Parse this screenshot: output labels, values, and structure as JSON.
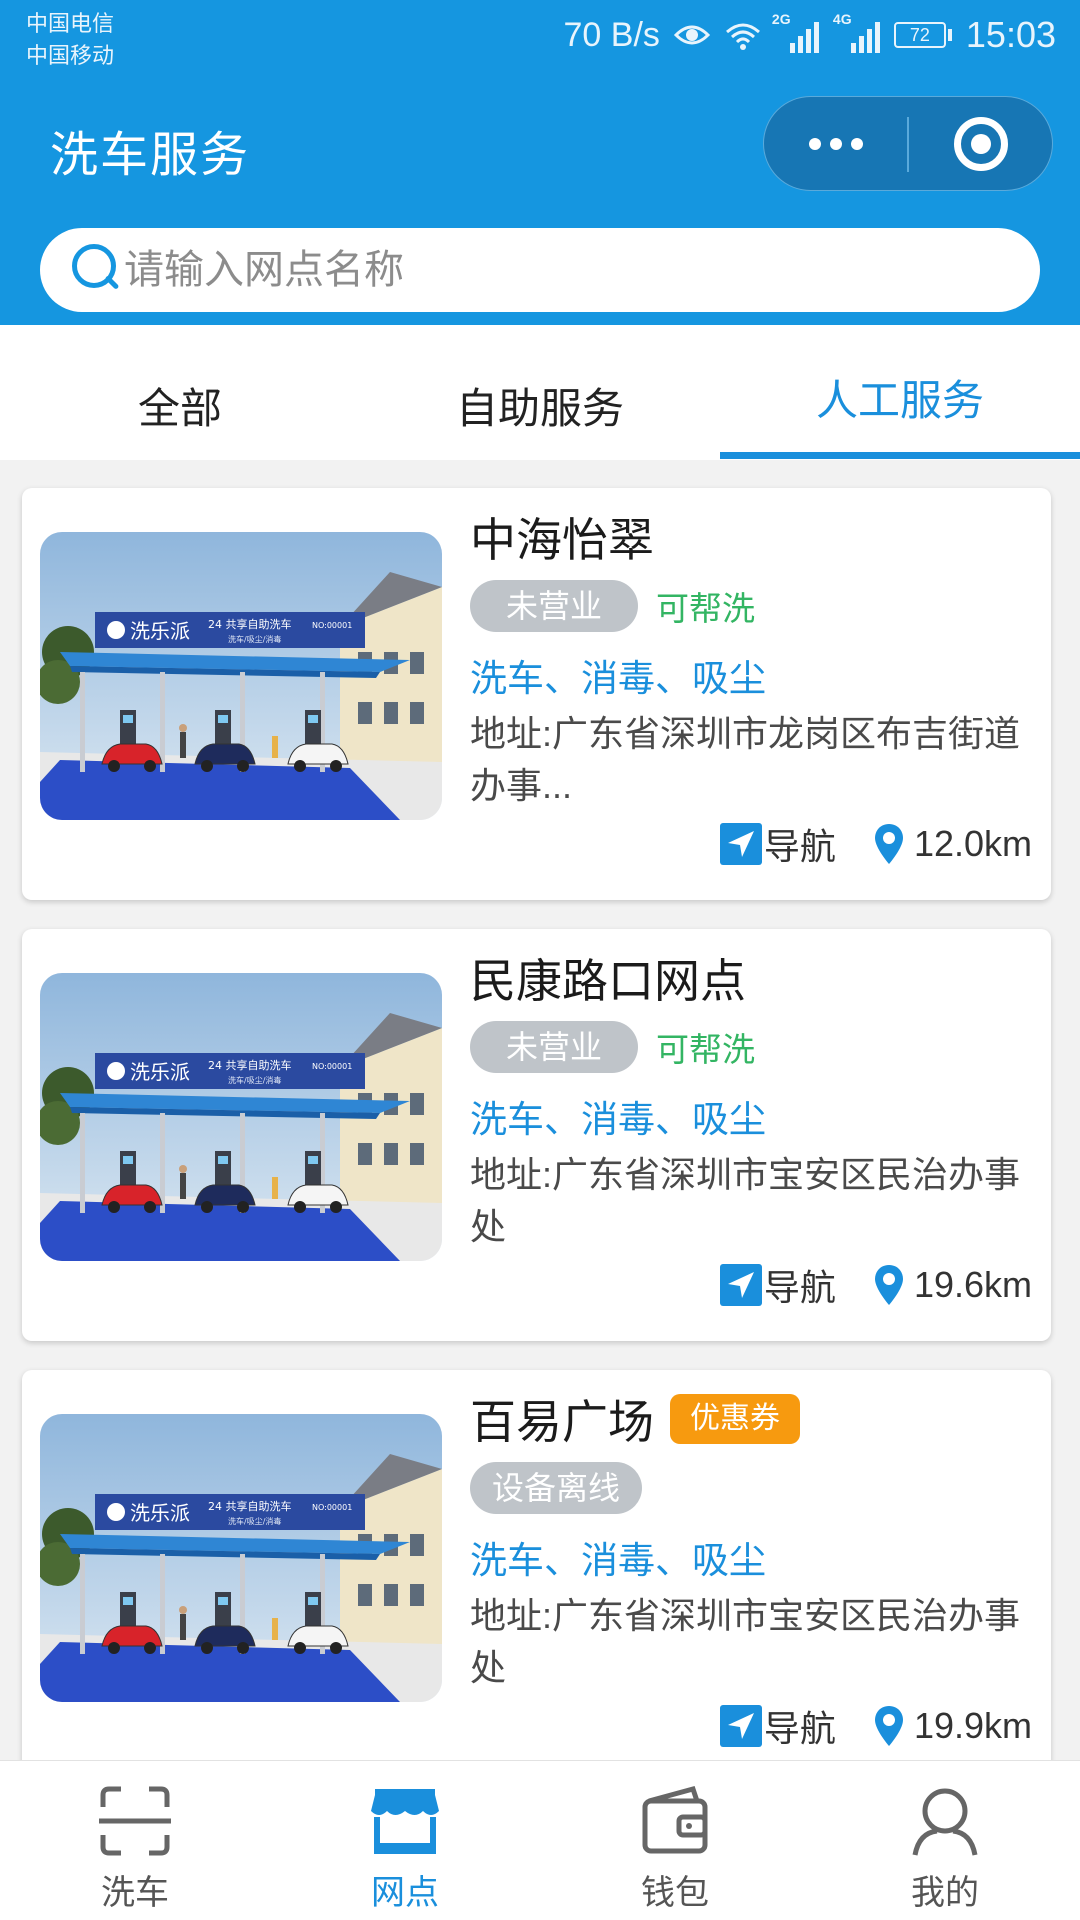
{
  "status_bar": {
    "carrier_1": "中国电信",
    "carrier_2": "中国移动",
    "net_speed": "70 B/s",
    "sig1_label": "2G",
    "sig2_label": "4G",
    "battery": "72",
    "time": "15:03",
    "icons": [
      "eye-icon",
      "wifi-icon",
      "signal-icon",
      "battery-icon"
    ]
  },
  "header": {
    "title": "洗车服务",
    "more_icon": "more-dots-icon",
    "close_icon": "target-circle-icon"
  },
  "search": {
    "placeholder": "请输入网点名称",
    "value": "",
    "icon": "search-icon"
  },
  "tabs": [
    {
      "label": "全部",
      "active": false
    },
    {
      "label": "自助服务",
      "active": false
    },
    {
      "label": "人工服务",
      "active": true
    }
  ],
  "stations": [
    {
      "name": "中海怡翠",
      "coupon": "",
      "status": "未营业",
      "help_wash": "可帮洗",
      "services": "洗车、消毒、吸尘",
      "address": "地址:广东省深圳市龙岗区布吉街道办事...",
      "nav_label": "导航",
      "distance": "12.0km"
    },
    {
      "name": "民康路口网点",
      "coupon": "",
      "status": "未营业",
      "help_wash": "可帮洗",
      "services": "洗车、消毒、吸尘",
      "address": "地址:广东省深圳市宝安区民治办事处",
      "nav_label": "导航",
      "distance": "19.6km"
    },
    {
      "name": "百易广场",
      "coupon": "优惠券",
      "status": "设备离线",
      "help_wash": "",
      "services": "洗车、消毒、吸尘",
      "address": "地址:广东省深圳市宝安区民治办事处",
      "nav_label": "导航",
      "distance": "19.9km"
    }
  ],
  "station_image": {
    "brand": "洗乐派",
    "slogan": "24 共享自助洗车",
    "sub": "洗车/吸尘/消毒",
    "code": "NO:00001"
  },
  "tabbar": [
    {
      "label": "洗车",
      "icon": "scan-icon",
      "active": false
    },
    {
      "label": "网点",
      "icon": "store-icon",
      "active": true
    },
    {
      "label": "钱包",
      "icon": "wallet-icon",
      "active": false
    },
    {
      "label": "我的",
      "icon": "user-icon",
      "active": false
    }
  ],
  "colors": {
    "primary": "#1596e0",
    "accent_blue": "#1a8fdc",
    "green": "#33b563",
    "coupon_orange": "#f79a0f",
    "badge_gray": "#bfc4c9"
  }
}
